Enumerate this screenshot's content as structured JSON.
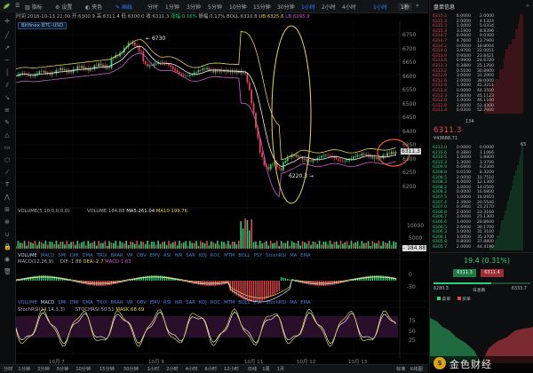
{
  "topbar": {
    "exchange_logo": "bitfinex-icon",
    "items": [
      "分时",
      "1分钟",
      "3分钟",
      "5分钟",
      "10分钟",
      "15分钟",
      "30分钟",
      "1小时",
      "2小时",
      "4小时",
      "6小时",
      "12小时",
      "日线"
    ],
    "left_items": [
      "指标",
      "设置",
      "夹色",
      "画线"
    ],
    "active": "1小时",
    "button_right": "1秒"
  },
  "info": {
    "time": "时间:2018-10-13 22:00",
    "open": "开:6300.9",
    "high": "高:6311.4",
    "low": "低:6300.0",
    "close": "收:6311.3",
    "change": "涨幅:0.16%",
    "amp": "振幅:0.17%",
    "boll": "BOLL:6310.8",
    "ub": "UB:6325.6",
    "lb": "LB:6295.9"
  },
  "symbol": "Bitfinex·BTC-USD",
  "price_axis": [
    "6750",
    "6700",
    "6650",
    "6600",
    "6550",
    "6500",
    "6450",
    "6400",
    "6350",
    "6300",
    "6250",
    "6200"
  ],
  "price_axis_colors": {
    "up": "#2bd07a",
    "down": "#e5464c",
    "axis": "#8e9296",
    "boll_mid": "#f2f2f2",
    "boll_band": "#cf5bd6",
    "yellow": "#e8d35a"
  },
  "annotations": {
    "high": "6730",
    "low": "6220.3",
    "current": "6311.3"
  },
  "volume_panel": {
    "title": "VOLUME(5,10,0,0,0,0)",
    "volume": "VOLUME:184.88",
    "ma5": "MA5:261.04",
    "ma10": "MA10:199.76",
    "axis": [
      "10000",
      "5000"
    ],
    "current": "184.88",
    "tabs": [
      "VOLUME",
      "MACD",
      "SMI",
      "DMI",
      "DMA",
      "TRIX",
      "BRAR",
      "VR",
      "OBV",
      "EMV",
      "RSI",
      "WR",
      "SAR",
      "KDJ",
      "ROC",
      "MTM",
      "BOLL",
      "PSY",
      "StochRSI",
      "MA",
      "EMA"
    ]
  },
  "macd_panel": {
    "title": "MACD(12,26,9)",
    "dif": "DIF:-1.88",
    "dea": "DEA:-2.7",
    "macd": "MACD:1.63",
    "axis": [
      "0",
      "-50"
    ],
    "tabs": [
      "VOLUME",
      "MACD",
      "SMI",
      "DMI",
      "DMA",
      "TRIX",
      "BRAR",
      "VR",
      "OBV",
      "EMV",
      "RSI",
      "WR",
      "SAR",
      "KDJ",
      "ROC",
      "MTM",
      "BOLL",
      "PSY",
      "StochRSI",
      "MA",
      "EMA"
    ]
  },
  "stoch_panel": {
    "title": "StochRSI(14,14,3,3)",
    "stochrsi": "STOCHRSI:50.51",
    "mask": "MASK:68.69",
    "axis": [
      "75",
      "50",
      "25"
    ],
    "tabs": [
      "VOLUME",
      "MACD",
      "SMI",
      "DMI",
      "DMA",
      "TRIX",
      "BRAR",
      "VR",
      "OBV",
      "EMV",
      "RSI",
      "WR",
      "SAR",
      "KDJ",
      "ROC",
      "MTM",
      "BOLL",
      "PSY",
      "StochRSI",
      "MA",
      "EMA"
    ]
  },
  "date_axis": [
    "10月 7",
    "10月 9",
    "10月 11",
    "10月 12",
    "10月 13"
  ],
  "bottombar": {
    "items": [
      "分时",
      "1分钟",
      "3分钟",
      "5分钟",
      "10分钟",
      "15分钟",
      "30分钟",
      "1小时",
      "2小时",
      "4小时",
      "6小时",
      "12小时",
      "日线",
      "1周",
      "1月"
    ],
    "right": [
      "标准",
      "K线图"
    ]
  },
  "orderbook": {
    "title": "盘单信息",
    "asks": [
      {
        "p": "6315.3",
        "q": "6.0000",
        "t": "2.0000"
      },
      {
        "p": "6315.3",
        "q": "2.0000",
        "t": "4.1324"
      },
      {
        "p": "6315.3",
        "q": "1.0000",
        "t": "5.0334"
      },
      {
        "p": "6315.3",
        "q": "3.1900",
        "t": "8.8390"
      },
      {
        "p": "6314.7",
        "q": "0.0600",
        "t": "9.0300"
      },
      {
        "p": "6314.7",
        "q": "4.7600",
        "t": "13.7900"
      },
      {
        "p": "6314.2",
        "q": "0.0000",
        "t": "18.8004"
      },
      {
        "p": "6314.0",
        "q": "3.9700",
        "t": "22.0051"
      },
      {
        "p": "6313.9",
        "q": "0.9500",
        "t": "23.8421"
      },
      {
        "p": "6313.6",
        "q": "0.9900",
        "t": "24.6720"
      },
      {
        "p": "6313.3",
        "q": "0.3880",
        "t": "25.1200"
      },
      {
        "p": "6313.2",
        "q": "0.5100",
        "t": "30.8900"
      },
      {
        "p": "6312.9",
        "q": "3.0000",
        "t": "31.2000"
      },
      {
        "p": "6312.6",
        "q": "2.0000",
        "t": "38.0000"
      },
      {
        "p": "6312.6",
        "q": "1.0000",
        "t": "42.3211"
      },
      {
        "p": "6312.4",
        "q": "0.0000",
        "t": "44.3500"
      },
      {
        "p": "6312.3",
        "q": "2.6000",
        "t": "45.1123"
      },
      {
        "p": "6312.0",
        "q": "1.0000",
        "t": "46.1100"
      },
      {
        "p": "6311.9",
        "q": "2.0000",
        "t": "52.4300"
      },
      {
        "p": "6311.4",
        "q": "0.0300",
        "t": "52.7900"
      }
    ],
    "bids": [
      {
        "p": "6311.0",
        "q": "0.0000",
        "t": "0.0000"
      },
      {
        "p": "6310.6",
        "q": "0.3880",
        "t": "1.1066"
      },
      {
        "p": "6310.5",
        "q": "1.0000",
        "t": "1.8900"
      },
      {
        "p": "6310.3",
        "q": "1.3000",
        "t": "3.3700"
      },
      {
        "p": "6309.9",
        "q": "0.6900",
        "t": "6.2300"
      },
      {
        "p": "6308.8",
        "q": "0.0100",
        "t": "8.3200"
      },
      {
        "p": "6308.5",
        "q": "2.0000",
        "t": "10.7510"
      },
      {
        "p": "6308.3",
        "q": "4.0000",
        "t": "12.1300"
      },
      {
        "p": "6308.2",
        "q": "3.0000",
        "t": "14.0500"
      },
      {
        "p": "6308.2",
        "q": "0.0000",
        "t": "16.6800"
      },
      {
        "p": "6307.5",
        "q": "1.0000",
        "t": "18.0910"
      },
      {
        "p": "6307.4",
        "q": "2.3900",
        "t": "20.5540"
      },
      {
        "p": "6307.0",
        "q": "0.3900",
        "t": "21.2170"
      },
      {
        "p": "6306.8",
        "q": "2.0000",
        "t": "23.3160"
      },
      {
        "p": "6306.7",
        "q": "3.0000",
        "t": "25.1300"
      },
      {
        "p": "6306.6",
        "q": "1.0000",
        "t": "28.8600"
      },
      {
        "p": "6306.5",
        "q": "2.6000",
        "t": "30.1700"
      },
      {
        "p": "6306.3",
        "q": "1.0000",
        "t": "31.3100"
      },
      {
        "p": "6306.1",
        "q": "1.0000",
        "t": "35.3700"
      },
      {
        "p": "6305.8",
        "q": "0.8000",
        "t": "37.8800"
      },
      {
        "p": "6305.7",
        "q": "2.0000",
        "t": "44.4190"
      }
    ],
    "last_price": "6311.3",
    "last_cny": "¥43688.71",
    "side_labels": {
      "ask": "134",
      "mid": "65",
      "bid": "65"
    },
    "change": "19.4 (0.31%)",
    "btn_sell": "6311.3",
    "btn_buy": "6311.4",
    "range_left": "6280.3",
    "range_mid": "日涨跌",
    "range_right": "6333.7",
    "legend_sell": "卖单",
    "legend_buy": "买单",
    "depth_axis": [
      "6310",
      "6330"
    ]
  },
  "watermark": "金色财经"
}
